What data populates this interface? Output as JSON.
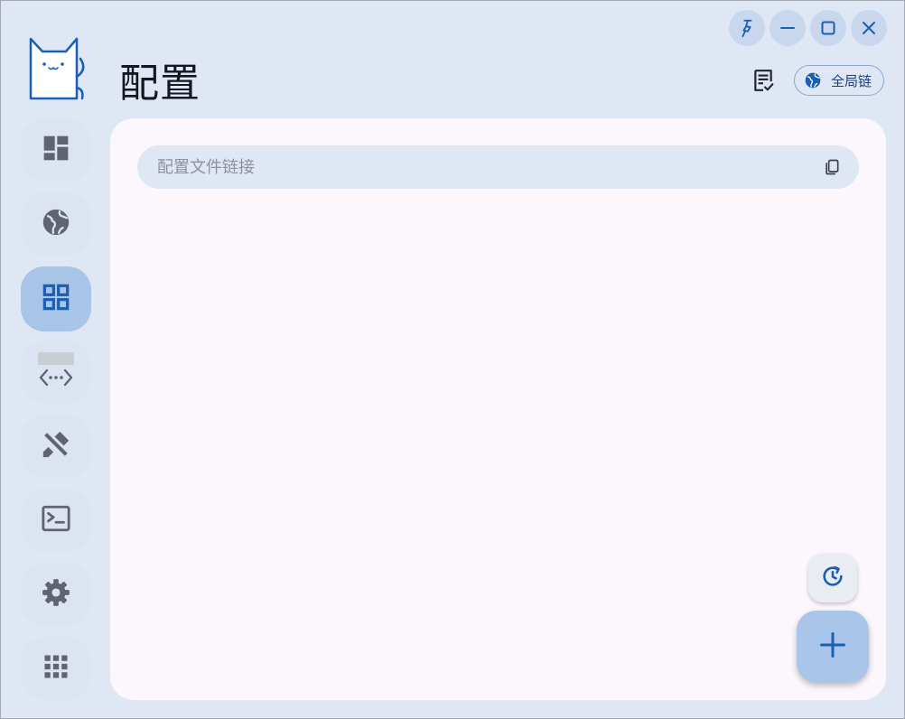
{
  "header": {
    "title": "配置",
    "mode_chip_label": "全局链"
  },
  "window_controls": {
    "pin_icon": "pin-icon",
    "minimize_icon": "minimize-icon",
    "maximize_icon": "maximize-icon",
    "close_icon": "close-icon"
  },
  "sidebar": {
    "logo_icon": "cat-logo-icon",
    "items": [
      {
        "icon": "dashboard-icon",
        "active": false
      },
      {
        "icon": "globe-icon",
        "active": false
      },
      {
        "icon": "grid-icon",
        "active": true
      },
      {
        "icon": "connections-icon",
        "active": false
      },
      {
        "icon": "tools-icon",
        "active": false
      },
      {
        "icon": "terminal-icon",
        "active": false
      },
      {
        "icon": "settings-icon",
        "active": false
      },
      {
        "icon": "apps-icon",
        "active": false
      }
    ]
  },
  "main": {
    "url_input": {
      "value": "",
      "placeholder": "配置文件链接"
    }
  },
  "colors": {
    "window_bg": "#e0e7f4",
    "panel_bg": "#fbf7fc",
    "accent": "#1a5fb4",
    "active_nav": "#a8c4e6",
    "icon_gray": "#5f6470",
    "fab_bg": "#a9c6ea"
  }
}
